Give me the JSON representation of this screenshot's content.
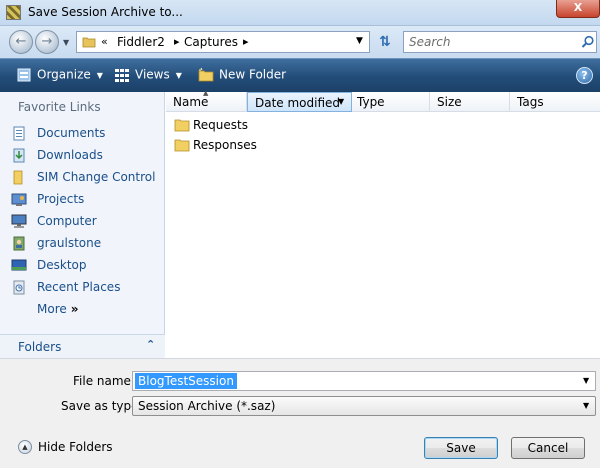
{
  "window": {
    "title": "Save Session Archive to...",
    "close_label": "X"
  },
  "address": {
    "overflow": "«",
    "crumbs": [
      "Fiddler2",
      "Captures"
    ],
    "search_placeholder": "Search"
  },
  "toolbar": {
    "organize": "Organize",
    "views": "Views",
    "new_folder": "New Folder",
    "help": "?"
  },
  "nav": {
    "favorites_header": "Favorite Links",
    "items": [
      {
        "label": "Documents",
        "icon": "documents-icon"
      },
      {
        "label": "Downloads",
        "icon": "downloads-icon"
      },
      {
        "label": "SIM Change Control",
        "icon": "folder-icon"
      },
      {
        "label": "Projects",
        "icon": "projects-icon"
      },
      {
        "label": "Computer",
        "icon": "computer-icon"
      },
      {
        "label": "graulstone",
        "icon": "user-folder-icon"
      },
      {
        "label": "Desktop",
        "icon": "desktop-icon"
      },
      {
        "label": "Recent Places",
        "icon": "recent-places-icon"
      }
    ],
    "more": "More",
    "more_arrows": "»",
    "folders": "Folders"
  },
  "filelist": {
    "columns": [
      "Name",
      "Date modified",
      "Type",
      "Size",
      "Tags"
    ],
    "rows": [
      {
        "name": "Requests"
      },
      {
        "name": "Responses"
      }
    ]
  },
  "form": {
    "filename_label": "File name:",
    "filename_value": "BlogTestSession",
    "savetype_label": "Save as type:",
    "savetype_value": "Session Archive (*.saz)",
    "hide_folders": "Hide Folders",
    "save": "Save",
    "cancel": "Cancel"
  },
  "colors": {
    "toolbar_bg": "#224c78",
    "nav_link": "#1a4f8a",
    "selection": "#3399ff"
  }
}
